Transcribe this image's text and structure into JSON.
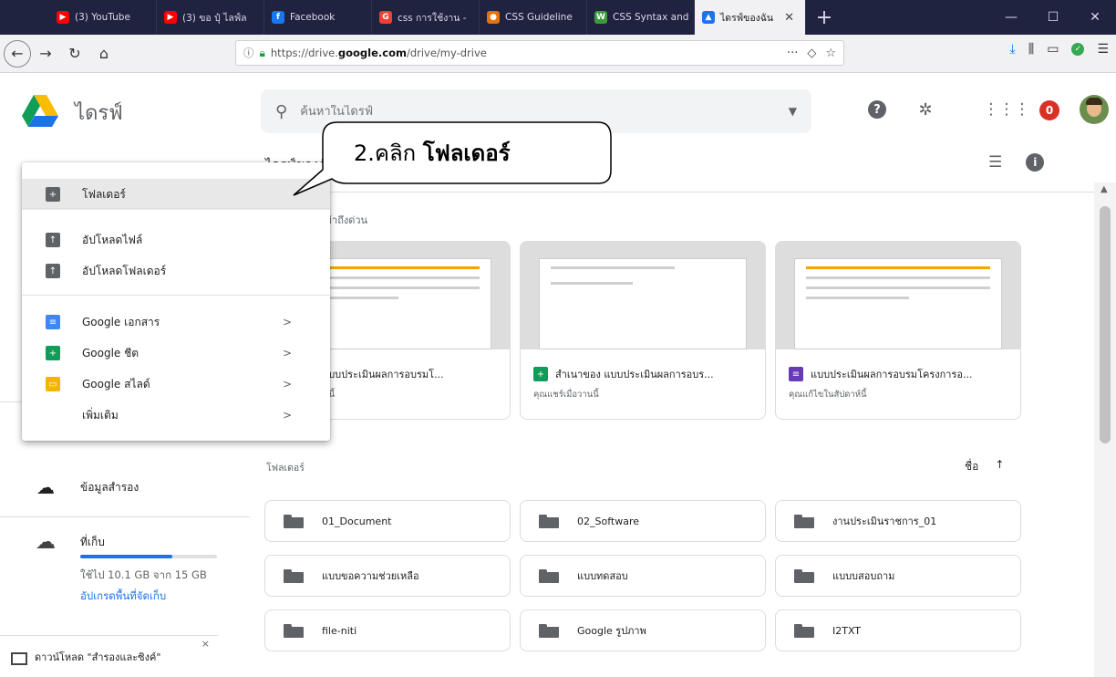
{
  "browser": {
    "tabs": [
      {
        "label": "(3) YouTube",
        "color": "#ff0000",
        "glyph": "▶",
        "width": 118
      },
      {
        "label": "(3) ขอ ปุ๋ ไลฟ์ล",
        "color": "#ff0000",
        "glyph": "▶",
        "width": 118
      },
      {
        "label": "Facebook",
        "color": "#1877f2",
        "glyph": "f",
        "width": 118
      },
      {
        "label": "css การใช้งาน -",
        "color": "#ea4335",
        "glyph": "G",
        "width": 118
      },
      {
        "label": "CSS Guideline",
        "color": "#e8710a",
        "glyph": "●",
        "width": 118
      },
      {
        "label": "CSS Syntax and",
        "color": "#3c9c3c",
        "glyph": "W",
        "width": 118
      },
      {
        "label": "ไดรฟ์ของฉัน",
        "color": "#1a73e8",
        "glyph": "▲",
        "width": 122,
        "active": true
      }
    ],
    "url_prefix": "https://drive.",
    "url_domain": "google.com",
    "url_suffix": "/drive/my-drive"
  },
  "drive": {
    "app_name": "ไดรฟ์",
    "search_placeholder": "ค้นหาในไดรฟ์",
    "my_drive_title": "ไดรฟ์ของฉัน",
    "quick_access_label": "การเข้าถึงด่วน",
    "folders_label": "โฟลเดอร์",
    "sort_label": "ชื่อ",
    "notification_count": "0"
  },
  "sidebar": {
    "backup_label": "ข้อมูลสำรอง",
    "storage_label": "ที่เก็บ",
    "storage_used": "ใช้ไป 10.1 GB จาก 15 GB",
    "storage_fraction": 0.67,
    "upgrade_label": "อัปเกรดพื้นที่จัดเก็บ",
    "download_text": "ดาวน์โหลด \"สำรองและซิงค์\""
  },
  "new_menu": {
    "items": [
      {
        "label": "โฟลเดอร์",
        "icon": "new-folder-icon"
      },
      {
        "label": "อัปโหลดไฟล์",
        "icon": "file-upload-icon"
      },
      {
        "label": "อัปโหลดโฟลเดอร์",
        "icon": "folder-upload-icon"
      },
      {
        "label": "Google เอกสาร",
        "icon": "docs-icon"
      },
      {
        "label": "Google ชีต",
        "icon": "sheets-icon"
      },
      {
        "label": "Google สไลด์",
        "icon": "slides-icon"
      },
      {
        "label": "เพิ่มเติม",
        "icon": "more-icon"
      }
    ]
  },
  "quick_access": [
    {
      "name": "y of แบบประเมินผลการอบรมโ...",
      "sub": "น์ แก้ไขในวันนี้",
      "icon_color": "#f4b400",
      "icon_glyph": ""
    },
    {
      "name": "สำเนาของ แบบประเมินผลการอบร...",
      "sub": "คุณแชร์เมื่อวานนี้",
      "icon_color": "#0f9d58",
      "icon_glyph": "+"
    },
    {
      "name": "แบบประเมินผลการอบรมโครงการอ...",
      "sub": "คุณแก้ไขในสัปดาห์นี้",
      "icon_color": "#673ab7",
      "icon_glyph": "≡"
    }
  ],
  "folders": [
    {
      "name": "01_Document"
    },
    {
      "name": "02_Software"
    },
    {
      "name": "งานประเมินราชการ_01"
    },
    {
      "name": "แบบขอความช่วยเหลือ"
    },
    {
      "name": "แบบทดสอบ"
    },
    {
      "name": "แบบบสอบถาม"
    },
    {
      "name": "file-niti"
    },
    {
      "name": "Google รูปภาพ"
    },
    {
      "name": "I2TXT"
    }
  ],
  "callout": {
    "prefix": "2.คลิก ",
    "bold": "โฟลเดอร์"
  }
}
